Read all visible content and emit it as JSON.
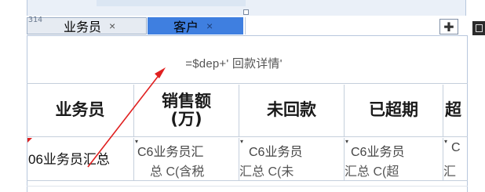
{
  "row_number": "314",
  "tabs": [
    {
      "label": "业务员",
      "close": "×",
      "active": false
    },
    {
      "label": "客户",
      "close": "×",
      "active": true
    }
  ],
  "add_button": "✚",
  "formula": "=$dep+' 回款详情'",
  "headers": [
    "业务员",
    "销售额\n(万)",
    "未回款",
    "已超期",
    "超"
  ],
  "row": {
    "first": "06业务员汇总",
    "cells": [
      {
        "line1": "C6业务员汇",
        "line2": "总 C(含税"
      },
      {
        "line1": "C6业务员",
        "line2": "汇总 C(未"
      },
      {
        "line1": "C6业务员",
        "line2": "汇总 C(超"
      },
      {
        "line1": "C",
        "line2": "汇"
      }
    ]
  },
  "colors": {
    "active_tab": "#3f7fe0",
    "annotation_arrow": "#e02020"
  }
}
